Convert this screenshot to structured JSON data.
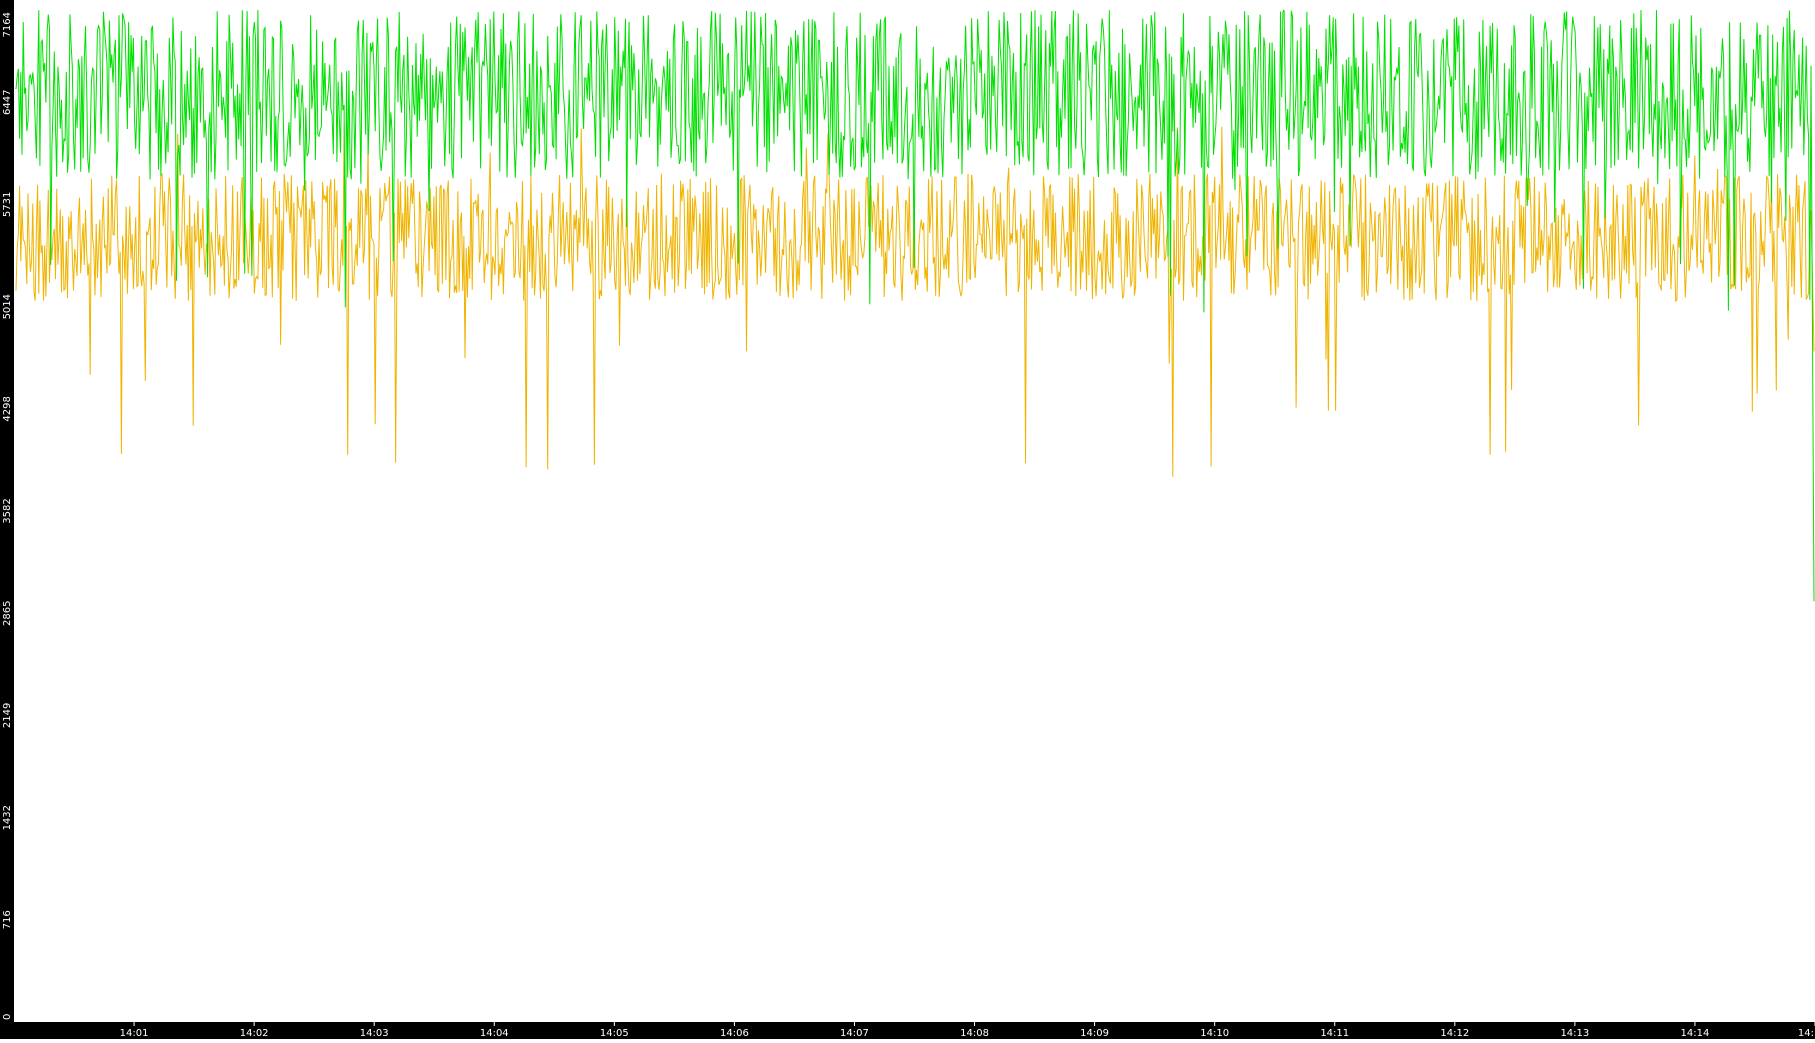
{
  "chart_data": {
    "type": "line",
    "title": "",
    "xlabel": "",
    "ylabel": "",
    "ylim": [
      0,
      7164
    ],
    "y_ticks": [
      "0",
      "716",
      "1432",
      "2149",
      "2865",
      "3582",
      "4298",
      "5014",
      "5731",
      "6447",
      "7164"
    ],
    "y_tick_values": [
      0,
      716,
      1432,
      2149,
      2865,
      3582,
      4298,
      5014,
      5731,
      6447,
      7164
    ],
    "x_ticks": [
      "14:01",
      "14:02",
      "14:03",
      "14:04",
      "14:05",
      "14:06",
      "14:07",
      "14:08",
      "14:09",
      "14:10",
      "14:11",
      "14:12",
      "14:13",
      "14:14",
      "14:15"
    ],
    "x_tick_label_visible": [
      "14:01",
      "14:02",
      "14:03",
      "14:04",
      "14:05",
      "14:06",
      "14:07",
      "14:08",
      "14:09",
      "14:10",
      "14:11",
      "14:12",
      "14:13",
      "14:14",
      "14:"
    ],
    "x_range": [
      "14:00:00",
      "14:15:00"
    ],
    "grid": false,
    "background": "#ffffff",
    "frame_color": "#000000",
    "tick_label_color": "#ffffff",
    "series": [
      {
        "color": "#00e000",
        "mean": 6500,
        "typical_range": [
          5700,
          7100
        ],
        "min_spike": 4950,
        "max_spike": 7164,
        "last_value": 2950
      },
      {
        "color": "#f0b400",
        "mean": 5500,
        "typical_range": [
          4900,
          5950
        ],
        "min_spike": 3800,
        "max_spike": 6300,
        "last_value": 4700
      }
    ]
  }
}
